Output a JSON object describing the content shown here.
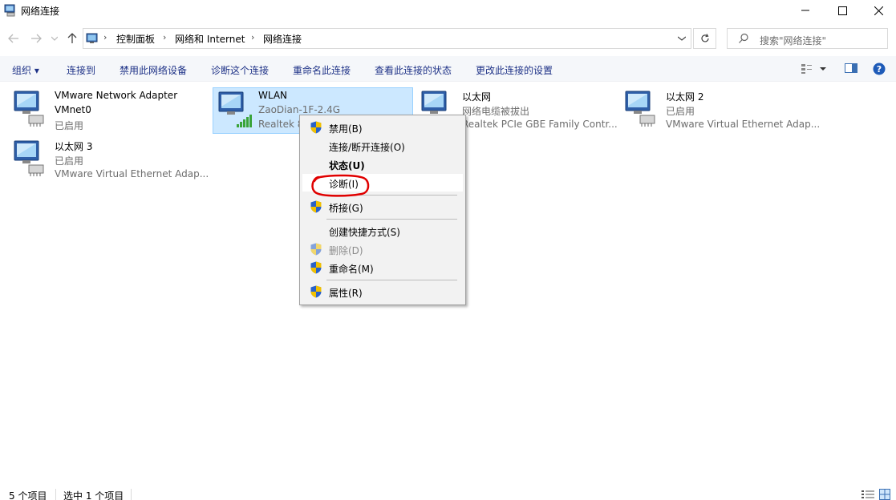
{
  "window": {
    "title": "网络连接"
  },
  "breadcrumb": [
    "控制面板",
    "网络和 Internet",
    "网络连接"
  ],
  "search": {
    "placeholder": "搜索\"网络连接\""
  },
  "toolbar": {
    "organize": "组织 ▾",
    "items": [
      "连接到",
      "禁用此网络设备",
      "诊断这个连接",
      "重命名此连接",
      "查看此连接的状态",
      "更改此连接的设置"
    ]
  },
  "connections": [
    {
      "name": "VMware Network Adapter",
      "line2": "VMnet0",
      "line3": "已启用",
      "icon": "network-adapter-icon"
    },
    {
      "name": "WLAN",
      "line2": "ZaoDian-1F-2.4G",
      "line3": "Realtek 8",
      "icon": "wifi-adapter-icon",
      "selected": true
    },
    {
      "name": "以太网",
      "line2": "网络电缆被拔出",
      "line3": "Realtek PCIe GBE Family Contr...",
      "icon": "ethernet-disconnected-icon"
    },
    {
      "name": "以太网 2",
      "line2": "已启用",
      "line3": "VMware Virtual Ethernet Adap...",
      "icon": "network-adapter-icon"
    },
    {
      "name": "以太网 3",
      "line2": "已启用",
      "line3": "VMware Virtual Ethernet Adap...",
      "icon": "network-adapter-icon"
    }
  ],
  "context_menu": {
    "disable": "禁用(B)",
    "connect": "连接/断开连接(O)",
    "status": "状态(U)",
    "diagnose": "诊断(I)",
    "bridge": "桥接(G)",
    "shortcut": "创建快捷方式(S)",
    "delete": "删除(D)",
    "rename": "重命名(M)",
    "properties": "属性(R)"
  },
  "statusbar": {
    "count": "5 个项目",
    "selected": "选中 1 个项目"
  },
  "colors": {
    "accent": "#1e3287",
    "selection": "#cce8ff",
    "annotation": "#e00000"
  }
}
